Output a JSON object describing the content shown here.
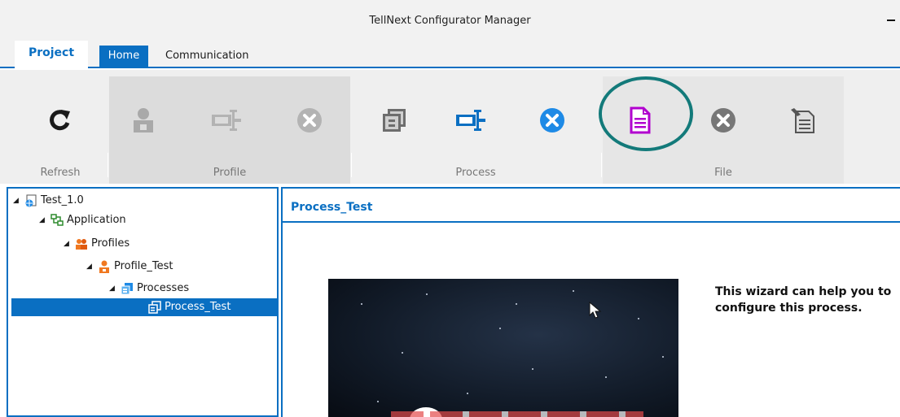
{
  "window": {
    "title": "TellNext Configurator Manager"
  },
  "tabs": [
    {
      "label": "Project"
    },
    {
      "label": "Home"
    },
    {
      "label": "Communication"
    }
  ],
  "ribbon": {
    "groups": {
      "refresh": "Refresh",
      "profile": "Profile",
      "process": "Process",
      "file": "File"
    },
    "buttons": {
      "refresh": {
        "icon": "refresh-icon",
        "enabled": true
      },
      "profile_add": {
        "icon": "add-profile-icon",
        "enabled": false
      },
      "profile_edit": {
        "icon": "edit-connector-icon",
        "enabled": false
      },
      "profile_delete": {
        "icon": "delete-icon",
        "enabled": false
      },
      "process_add": {
        "icon": "add-process-icon",
        "enabled": true
      },
      "process_edit": {
        "icon": "edit-connector-icon",
        "enabled": true
      },
      "process_delete": {
        "icon": "delete-icon",
        "enabled": true
      },
      "file_new": {
        "icon": "document-icon",
        "enabled": true,
        "highlighted": true
      },
      "file_delete": {
        "icon": "delete-icon",
        "enabled": true
      },
      "file_edit": {
        "icon": "edit-document-icon",
        "enabled": true
      }
    }
  },
  "tree": [
    {
      "label": "Test_1.0",
      "icon": "project-globe-icon",
      "expanded": true
    },
    {
      "label": "Application",
      "icon": "application-icon",
      "expanded": true
    },
    {
      "label": "Profiles",
      "icon": "profiles-icon",
      "expanded": true
    },
    {
      "label": "Profile_Test",
      "icon": "profile-icon",
      "expanded": true
    },
    {
      "label": "Processes",
      "icon": "processes-icon",
      "expanded": true
    },
    {
      "label": "Process_Test",
      "icon": "process-icon",
      "selected": true
    }
  ],
  "main": {
    "title": "Process_Test",
    "wizard_text": "This wizard can help you to configure this process."
  },
  "colors": {
    "accent": "#0a6fc2",
    "file_doc_icon": "#b100cf",
    "highlight_ring": "#137a7a"
  }
}
